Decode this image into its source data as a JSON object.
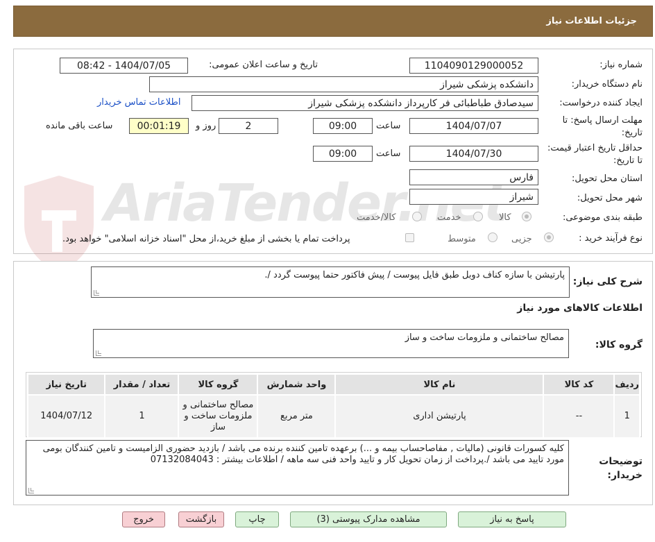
{
  "header": {
    "title": "جزئیات اطلاعات نیاز"
  },
  "form": {
    "need_number_label": "شماره نیاز:",
    "need_number": "1104090129000052",
    "announce_label": "تاریخ و ساعت اعلان عمومی:",
    "announce_value": "1404/07/05 - 08:42",
    "buyer_org_label": "نام دستگاه خریدار:",
    "buyer_org": "دانشکده پزشکی شیراز",
    "creator_label": "ایجاد کننده درخواست:",
    "creator": "سیدصادق طباطبائی فر کارپرداز دانشکده پزشکی شیراز",
    "contact_link": "اطلاعات تماس خریدار",
    "deadline_label": "مهلت ارسال پاسخ: تا تاریخ:",
    "deadline_date": "1404/07/07",
    "time_label": "ساعت",
    "deadline_time": "09:00",
    "days_value": "2",
    "days_label": "روز و",
    "remaining_time": "00:01:19",
    "remaining_label": "ساعت باقی مانده",
    "validity_label": "حداقل تاریخ اعتبار قیمت: تا تاریخ:",
    "validity_date": "1404/07/30",
    "validity_time": "09:00",
    "province_label": "استان محل تحویل:",
    "province": "فارس",
    "city_label": "شهر محل تحویل:",
    "city": "شیراز",
    "category_label": "طبقه بندی موضوعی:",
    "category_options": [
      "کالا",
      "خدمت",
      "کالا/خدمت"
    ],
    "process_label": "نوع فرآیند خرید :",
    "process_options": [
      "جزیی",
      "متوسط"
    ],
    "payment_note": "پرداخت تمام یا بخشی از مبلغ خرید،از محل \"اسناد خزانه اسلامی\" خواهد بود."
  },
  "description": {
    "label": "شرح کلی نیاز:",
    "text": "پارتیشن با سازه کناف دوبل طبق فایل پیوست / پیش فاکتور حتما پیوست گردد /."
  },
  "goods_section": {
    "title": "اطلاعات کالاهای مورد نیاز",
    "group_label": "گروه کالا:",
    "group_value": "مصالح ساختمانی و ملزومات ساخت و ساز"
  },
  "table": {
    "headers": [
      "ردیف",
      "کد کالا",
      "نام کالا",
      "واحد شمارش",
      "گروه کالا",
      "تعداد / مقدار",
      "تاریخ نیاز"
    ],
    "rows": [
      {
        "row": "1",
        "code": "--",
        "name": "پارتیشن اداری",
        "unit": "متر مربع",
        "group": "مصالح ساختمانی و ملزومات ساخت و ساز",
        "qty": "1",
        "date": "1404/07/12"
      }
    ]
  },
  "buyer_notes": {
    "label": "توضیحات خریدار:",
    "text": "کلیه کسورات قانونی (مالیات , مفاصاحساب بیمه و ...) برعهده تامین کننده برنده می باشد / بازدید حضوری الزامیست و تامین کنندگان بومی مورد تایید می باشد /.پرداخت از زمان تحویل کار و تایید واحد فنی سه ماهه / اطلاعات بیشتر : 07132084043"
  },
  "buttons": {
    "reply": "پاسخ به نیاز",
    "attachments": "مشاهده مدارک پیوستی (3)",
    "print": "چاپ",
    "back": "بازگشت",
    "exit": "خروج"
  },
  "colors": {
    "header_bg": "#8b6b3e",
    "link": "#1a4fc6",
    "remaining_bg": "#ffffc8",
    "button_green": "#d9f2d9",
    "button_pink": "#f8d0d4"
  }
}
